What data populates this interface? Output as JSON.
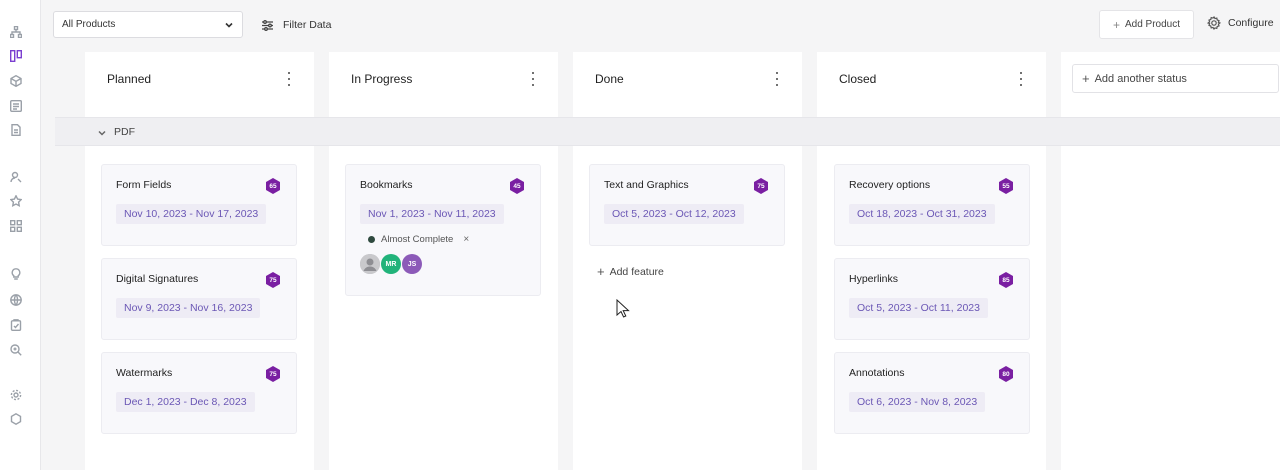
{
  "rail": {
    "icons": [
      "hierarchy-icon",
      "board-icon",
      "cube-icon",
      "list-icon",
      "document-icon",
      "user-search-icon",
      "star-icon",
      "grid-icon",
      "lightbulb-icon",
      "globe-icon",
      "clipboard-icon",
      "search-zoom-icon",
      "settings-icon",
      "hexagon-icon"
    ],
    "active": "board-icon",
    "active_color": "#7b3fd0"
  },
  "topbar": {
    "product_select_value": "All Products",
    "filter_label": "Filter Data",
    "add_product_label": "Add Product",
    "configure_label": "Configure"
  },
  "columns": [
    {
      "title": "Planned"
    },
    {
      "title": "In Progress"
    },
    {
      "title": "Done"
    },
    {
      "title": "Closed"
    }
  ],
  "add_status_label": "Add another status",
  "group": {
    "label": "PDF"
  },
  "cards": {
    "planned": [
      {
        "title": "Form Fields",
        "dates": "Nov 10, 2023 - Nov 17, 2023",
        "score": "65"
      },
      {
        "title": "Digital Signatures",
        "dates": "Nov 9, 2023 - Nov 16, 2023",
        "score": "75"
      },
      {
        "title": "Watermarks",
        "dates": "Dec 1, 2023 - Dec 8, 2023",
        "score": "75"
      }
    ],
    "in_progress": [
      {
        "title": "Bookmarks",
        "dates": "Nov 1, 2023 - Nov 11, 2023",
        "score": "45",
        "status": "Almost Complete",
        "status_close": "×",
        "avatars": [
          "",
          "MR",
          "JS"
        ]
      }
    ],
    "done": [
      {
        "title": "Text and Graphics",
        "dates": "Oct 5, 2023 - Oct 12, 2023",
        "score": "75"
      }
    ],
    "closed": [
      {
        "title": "Recovery options",
        "dates": "Oct 18, 2023 - Oct 31, 2023",
        "score": "55"
      },
      {
        "title": "Hyperlinks",
        "dates": "Oct 5, 2023 - Oct 11, 2023",
        "score": "85"
      },
      {
        "title": "Annotations",
        "dates": "Oct 6, 2023 - Nov 8, 2023",
        "score": "80"
      }
    ]
  },
  "add_feature_label": "Add feature",
  "colors": {
    "score_badge": "#7a1fa2",
    "date_text": "#6b57b5",
    "avatar_mr": "#21b37a",
    "avatar_js": "#8c5ab8"
  }
}
